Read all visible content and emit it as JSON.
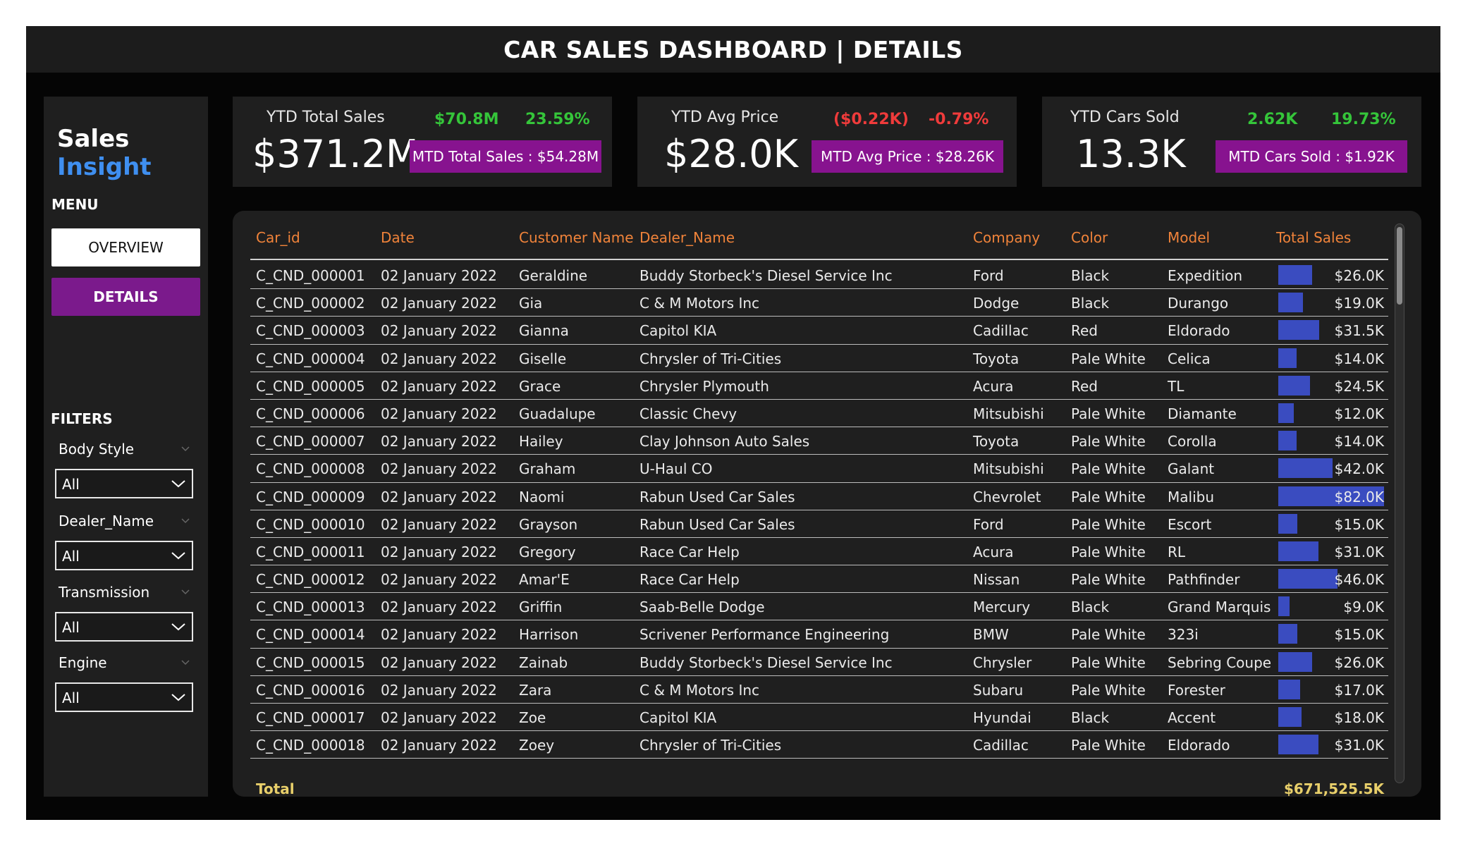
{
  "header": {
    "title": "CAR SALES DASHBOARD | DETAILS"
  },
  "sidebar": {
    "brand_part1": "Sales",
    "brand_part2": "Insight",
    "menu_label": "MENU",
    "overview_label": "OVERVIEW",
    "details_label": "DETAILS",
    "filters_label": "FILTERS",
    "filters": [
      {
        "name": "Body Style",
        "value": "All"
      },
      {
        "name": "Dealer_Name",
        "value": "All"
      },
      {
        "name": "Transmission",
        "value": "All"
      },
      {
        "name": "Engine",
        "value": "All"
      }
    ]
  },
  "kpis": [
    {
      "label": "YTD Total Sales",
      "value": "$371.2M",
      "delta": "$70.8M",
      "pct": "23.59%",
      "trend": "up",
      "mtd": "MTD Total Sales : $54.28M"
    },
    {
      "label": "YTD Avg Price",
      "value": "$28.0K",
      "delta": "($0.22K)",
      "pct": "-0.79%",
      "trend": "down",
      "mtd": "MTD Avg Price : $28.26K"
    },
    {
      "label": "YTD Cars Sold",
      "value": "13.3K",
      "delta": "2.62K",
      "pct": "19.73%",
      "trend": "up",
      "mtd": "MTD Cars Sold : $1.92K"
    }
  ],
  "colors": {
    "accent_purple": "#87138f",
    "header_orange": "#f0833a",
    "bar_blue": "#3a4cc0",
    "total_gold": "#e8cf6a",
    "up_green": "#35c53a",
    "down_red": "#ef3b3b",
    "brand_blue": "#3f8ff0"
  },
  "table": {
    "columns": [
      "Car_id",
      "Date",
      "Customer Name",
      "Dealer_Name",
      "Company",
      "Color",
      "Model",
      "Total Sales"
    ],
    "rows": [
      {
        "car_id": "C_CND_000001",
        "date": "02 January 2022",
        "customer": "Geraldine",
        "dealer": "Buddy Storbeck's Diesel Service Inc",
        "company": "Ford",
        "color": "Black",
        "model": "Expedition",
        "sales": "$26.0K",
        "sales_value": 26.0
      },
      {
        "car_id": "C_CND_000002",
        "date": "02 January 2022",
        "customer": "Gia",
        "dealer": "C & M Motors Inc",
        "company": "Dodge",
        "color": "Black",
        "model": "Durango",
        "sales": "$19.0K",
        "sales_value": 19.0
      },
      {
        "car_id": "C_CND_000003",
        "date": "02 January 2022",
        "customer": "Gianna",
        "dealer": "Capitol KIA",
        "company": "Cadillac",
        "color": "Red",
        "model": "Eldorado",
        "sales": "$31.5K",
        "sales_value": 31.5
      },
      {
        "car_id": "C_CND_000004",
        "date": "02 January 2022",
        "customer": "Giselle",
        "dealer": "Chrysler of Tri-Cities",
        "company": "Toyota",
        "color": "Pale White",
        "model": "Celica",
        "sales": "$14.0K",
        "sales_value": 14.0
      },
      {
        "car_id": "C_CND_000005",
        "date": "02 January 2022",
        "customer": "Grace",
        "dealer": "Chrysler Plymouth",
        "company": "Acura",
        "color": "Red",
        "model": "TL",
        "sales": "$24.5K",
        "sales_value": 24.5
      },
      {
        "car_id": "C_CND_000006",
        "date": "02 January 2022",
        "customer": "Guadalupe",
        "dealer": "Classic Chevy",
        "company": "Mitsubishi",
        "color": "Pale White",
        "model": "Diamante",
        "sales": "$12.0K",
        "sales_value": 12.0
      },
      {
        "car_id": "C_CND_000007",
        "date": "02 January 2022",
        "customer": "Hailey",
        "dealer": "Clay Johnson Auto Sales",
        "company": "Toyota",
        "color": "Pale White",
        "model": "Corolla",
        "sales": "$14.0K",
        "sales_value": 14.0
      },
      {
        "car_id": "C_CND_000008",
        "date": "02 January 2022",
        "customer": "Graham",
        "dealer": "U-Haul CO",
        "company": "Mitsubishi",
        "color": "Pale White",
        "model": "Galant",
        "sales": "$42.0K",
        "sales_value": 42.0
      },
      {
        "car_id": "C_CND_000009",
        "date": "02 January 2022",
        "customer": "Naomi",
        "dealer": "Rabun Used Car Sales",
        "company": "Chevrolet",
        "color": "Pale White",
        "model": "Malibu",
        "sales": "$82.0K",
        "sales_value": 82.0
      },
      {
        "car_id": "C_CND_000010",
        "date": "02 January 2022",
        "customer": "Grayson",
        "dealer": "Rabun Used Car Sales",
        "company": "Ford",
        "color": "Pale White",
        "model": "Escort",
        "sales": "$15.0K",
        "sales_value": 15.0
      },
      {
        "car_id": "C_CND_000011",
        "date": "02 January 2022",
        "customer": "Gregory",
        "dealer": "Race Car Help",
        "company": "Acura",
        "color": "Pale White",
        "model": "RL",
        "sales": "$31.0K",
        "sales_value": 31.0
      },
      {
        "car_id": "C_CND_000012",
        "date": "02 January 2022",
        "customer": "Amar'E",
        "dealer": "Race Car Help",
        "company": "Nissan",
        "color": "Pale White",
        "model": "Pathfinder",
        "sales": "$46.0K",
        "sales_value": 46.0
      },
      {
        "car_id": "C_CND_000013",
        "date": "02 January 2022",
        "customer": "Griffin",
        "dealer": "Saab-Belle Dodge",
        "company": "Mercury",
        "color": "Black",
        "model": "Grand Marquis",
        "sales": "$9.0K",
        "sales_value": 9.0
      },
      {
        "car_id": "C_CND_000014",
        "date": "02 January 2022",
        "customer": "Harrison",
        "dealer": "Scrivener Performance Engineering",
        "company": "BMW",
        "color": "Pale White",
        "model": "323i",
        "sales": "$15.0K",
        "sales_value": 15.0
      },
      {
        "car_id": "C_CND_000015",
        "date": "02 January 2022",
        "customer": "Zainab",
        "dealer": "Buddy Storbeck's Diesel Service Inc",
        "company": "Chrysler",
        "color": "Pale White",
        "model": "Sebring Coupe",
        "sales": "$26.0K",
        "sales_value": 26.0
      },
      {
        "car_id": "C_CND_000016",
        "date": "02 January 2022",
        "customer": "Zara",
        "dealer": "C & M Motors Inc",
        "company": "Subaru",
        "color": "Pale White",
        "model": "Forester",
        "sales": "$17.0K",
        "sales_value": 17.0
      },
      {
        "car_id": "C_CND_000017",
        "date": "02 January 2022",
        "customer": "Zoe",
        "dealer": "Capitol KIA",
        "company": "Hyundai",
        "color": "Black",
        "model": "Accent",
        "sales": "$18.0K",
        "sales_value": 18.0
      },
      {
        "car_id": "C_CND_000018",
        "date": "02 January 2022",
        "customer": "Zoey",
        "dealer": "Chrysler of Tri-Cities",
        "company": "Cadillac",
        "color": "Pale White",
        "model": "Eldorado",
        "sales": "$31.0K",
        "sales_value": 31.0
      }
    ],
    "total_label": "Total",
    "total_value": "$671,525.5K"
  }
}
